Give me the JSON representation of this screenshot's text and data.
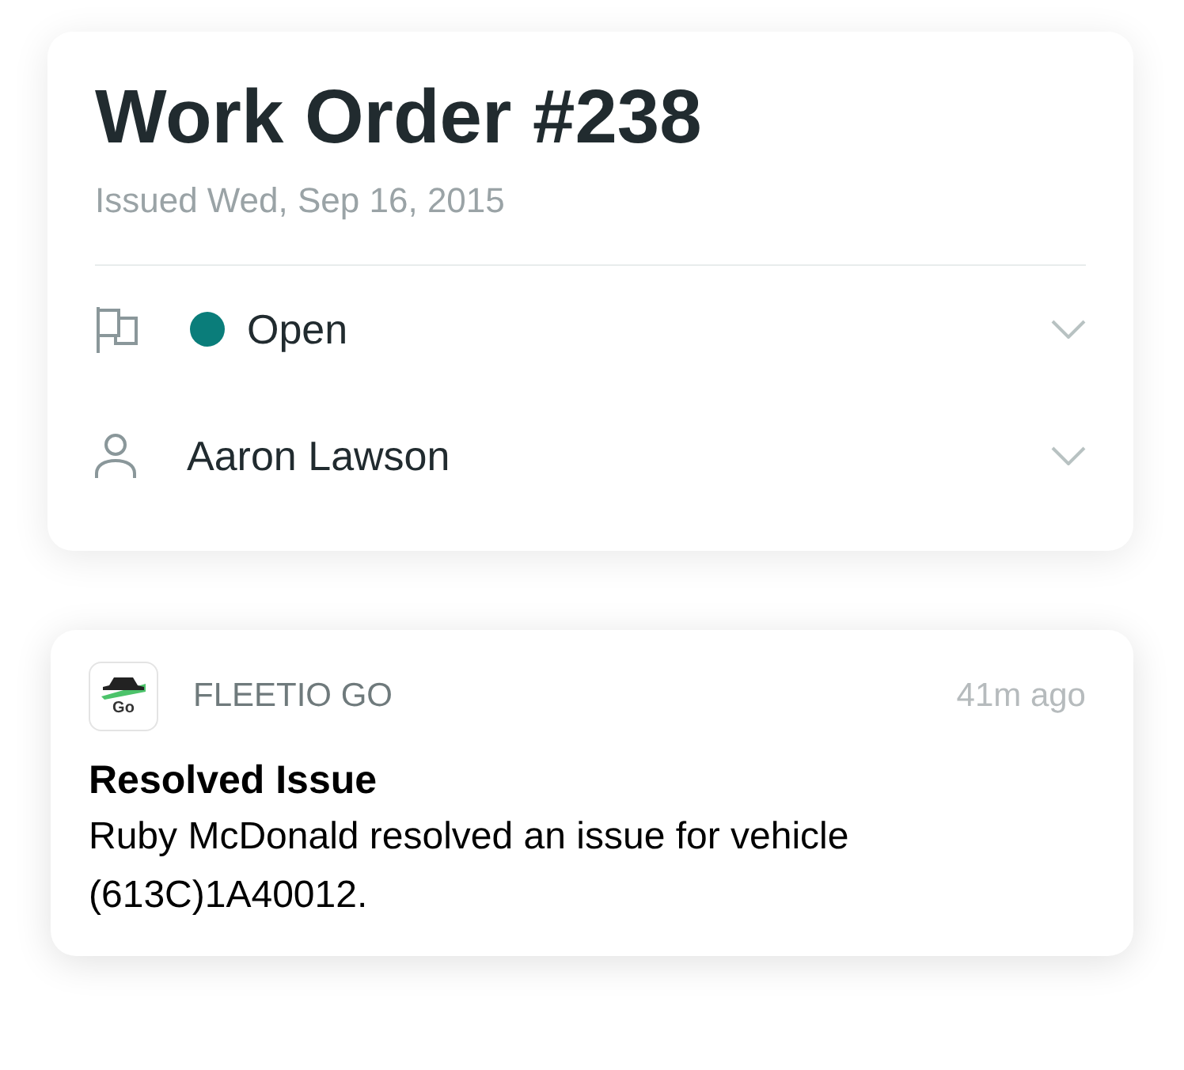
{
  "work_order": {
    "title": "Work Order #238",
    "issued": "Issued Wed, Sep 16, 2015",
    "fields": [
      {
        "kind": "status",
        "label": "Open",
        "color": "#0a7d7a"
      },
      {
        "kind": "assignee",
        "label": "Aaron Lawson"
      }
    ]
  },
  "notification": {
    "app_icon_label": "Go",
    "app_name": "FLEETIO GO",
    "time": "41m ago",
    "title": "Resolved Issue",
    "body": "Ruby McDonald resolved an issue for vehicle (613C)1A40012."
  }
}
